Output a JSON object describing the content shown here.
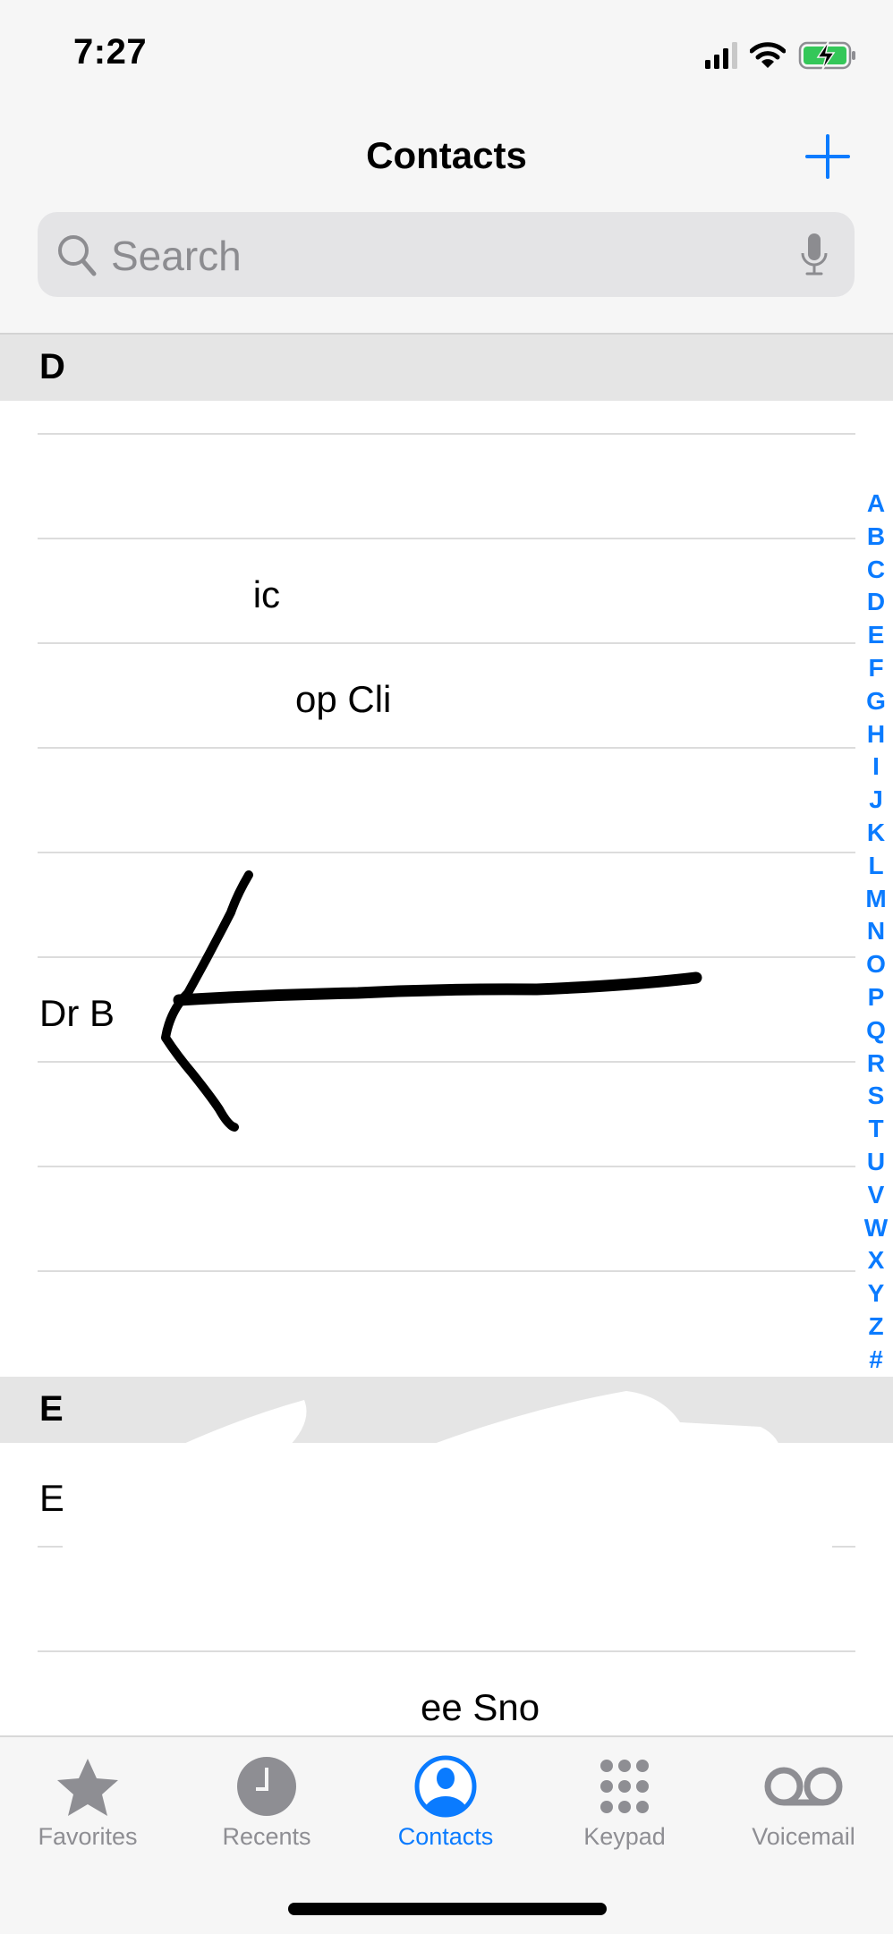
{
  "status_bar": {
    "time": "7:27",
    "icons": [
      "cellular-signal-icon",
      "wifi-icon",
      "battery-charging-icon"
    ],
    "battery_color": "#34c759"
  },
  "nav": {
    "title": "Contacts",
    "add_icon": "plus-icon"
  },
  "search": {
    "placeholder": "Search",
    "value": "",
    "icons": [
      "search-icon",
      "microphone-icon"
    ]
  },
  "sections": [
    {
      "letter": "D",
      "contacts": [
        {
          "name": ""
        },
        {
          "name": ""
        },
        {
          "name": "inic"
        },
        {
          "name": "op Cli"
        },
        {
          "name": ""
        },
        {
          "name": ""
        },
        {
          "name": "Dr B"
        },
        {
          "name": ""
        },
        {
          "name": ""
        },
        {
          "name": ""
        }
      ]
    },
    {
      "letter": "E",
      "contacts": [
        {
          "name": "E"
        },
        {
          "name": ""
        },
        {
          "name": "ee Sno"
        }
      ]
    }
  ],
  "index": [
    "A",
    "B",
    "C",
    "D",
    "E",
    "F",
    "G",
    "H",
    "I",
    "J",
    "K",
    "L",
    "M",
    "N",
    "O",
    "P",
    "Q",
    "R",
    "S",
    "T",
    "U",
    "V",
    "W",
    "X",
    "Y",
    "Z",
    "#"
  ],
  "annotation": {
    "type": "hand-drawn-arrow",
    "points_to": "Dr B"
  },
  "tab_bar": {
    "tabs": [
      {
        "label": "Favorites",
        "icon": "star-icon",
        "active": false
      },
      {
        "label": "Recents",
        "icon": "clock-icon",
        "active": false
      },
      {
        "label": "Contacts",
        "icon": "person-circle-icon",
        "active": true
      },
      {
        "label": "Keypad",
        "icon": "keypad-icon",
        "active": false
      },
      {
        "label": "Voicemail",
        "icon": "voicemail-icon",
        "active": false
      }
    ]
  },
  "colors": {
    "accent": "#0a7bff",
    "inactive": "#8e8e93",
    "section_header": "#e5e5e5"
  }
}
